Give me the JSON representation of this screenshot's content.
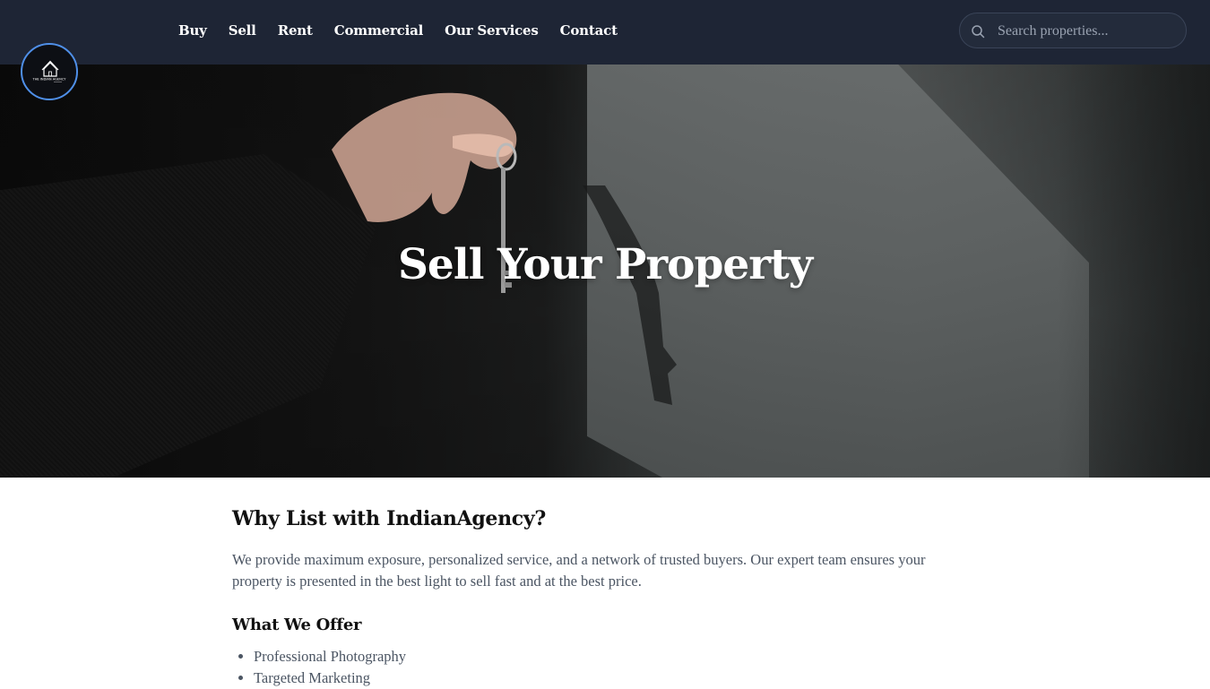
{
  "nav": {
    "links": [
      "Buy",
      "Sell",
      "Rent",
      "Commercial",
      "Our Services",
      "Contact"
    ],
    "search": {
      "placeholder": "Search properties...",
      "icon": "search-icon"
    },
    "logo": {
      "icon": "house-logo",
      "text": "THE INDIAN AGENCY",
      "accent": "#4f8fe8"
    }
  },
  "hero": {
    "title": "Sell Your Property"
  },
  "main": {
    "heading": "Why List with IndianAgency?",
    "intro": "We provide maximum exposure, personalized service, and a network of trusted buyers. Our expert team ensures your property is presented in the best light to sell fast and at the best price.",
    "offer_heading": "What We Offer",
    "offers": [
      "Professional Photography",
      "Targeted Marketing"
    ]
  },
  "colors": {
    "header_bg": "#1e2535",
    "logo_ring": "#4f8fe8",
    "text": "#4b5563",
    "heading": "#111111"
  }
}
